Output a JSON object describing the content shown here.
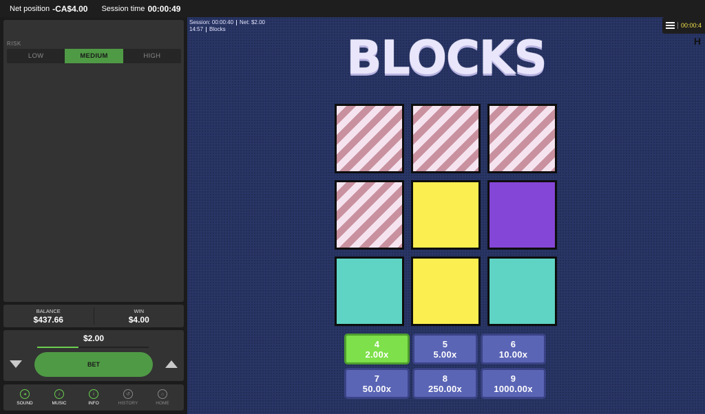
{
  "topbar": {
    "net_position_label": "Net position",
    "net_position_value": "-CA$4.00",
    "session_time_label": "Session time",
    "session_time_value": "00:00:49"
  },
  "risk": {
    "label": "RISK",
    "options": [
      "LOW",
      "MEDIUM",
      "HIGH"
    ],
    "selected": "MEDIUM"
  },
  "balance": {
    "label": "BALANCE",
    "value": "$437.66"
  },
  "win": {
    "label": "WIN",
    "value": "$4.00"
  },
  "bet": {
    "amount": "$2.00",
    "button_label": "BET",
    "slider_fraction": 0.37
  },
  "nav": [
    {
      "label": "SOUND",
      "icon": "speaker-icon",
      "active": true
    },
    {
      "label": "MUSIC",
      "icon": "music-note-icon",
      "active": true
    },
    {
      "label": "INFO",
      "icon": "info-icon",
      "active": true
    },
    {
      "label": "HISTORY",
      "icon": "history-icon",
      "active": false
    },
    {
      "label": "HOME",
      "icon": "home-icon",
      "active": false
    }
  ],
  "overlay": {
    "session": "Session: 00:00:40",
    "net": "Net:",
    "net_value": "$2.00",
    "clock": "14:57",
    "game_name": "Blocks"
  },
  "menu": {
    "time": "00:00:4"
  },
  "logo": "BLOCKS",
  "grid": [
    [
      "striped",
      "striped",
      "striped"
    ],
    [
      "striped",
      "yellow",
      "purple"
    ],
    [
      "teal",
      "yellow",
      "teal"
    ]
  ],
  "colors": {
    "yellow": "#fbee50",
    "purple": "#8446d6",
    "teal": "#5fd3c4",
    "accent_green": "#4f9a45",
    "background": "#283565"
  },
  "multipliers": [
    {
      "count": "4",
      "value": "2.00x",
      "hit": true
    },
    {
      "count": "5",
      "value": "5.00x",
      "hit": false
    },
    {
      "count": "6",
      "value": "10.00x",
      "hit": false
    },
    {
      "count": "7",
      "value": "50.00x",
      "hit": false
    },
    {
      "count": "8",
      "value": "250.00x",
      "hit": false
    },
    {
      "count": "9",
      "value": "1000.00x",
      "hit": false
    }
  ]
}
